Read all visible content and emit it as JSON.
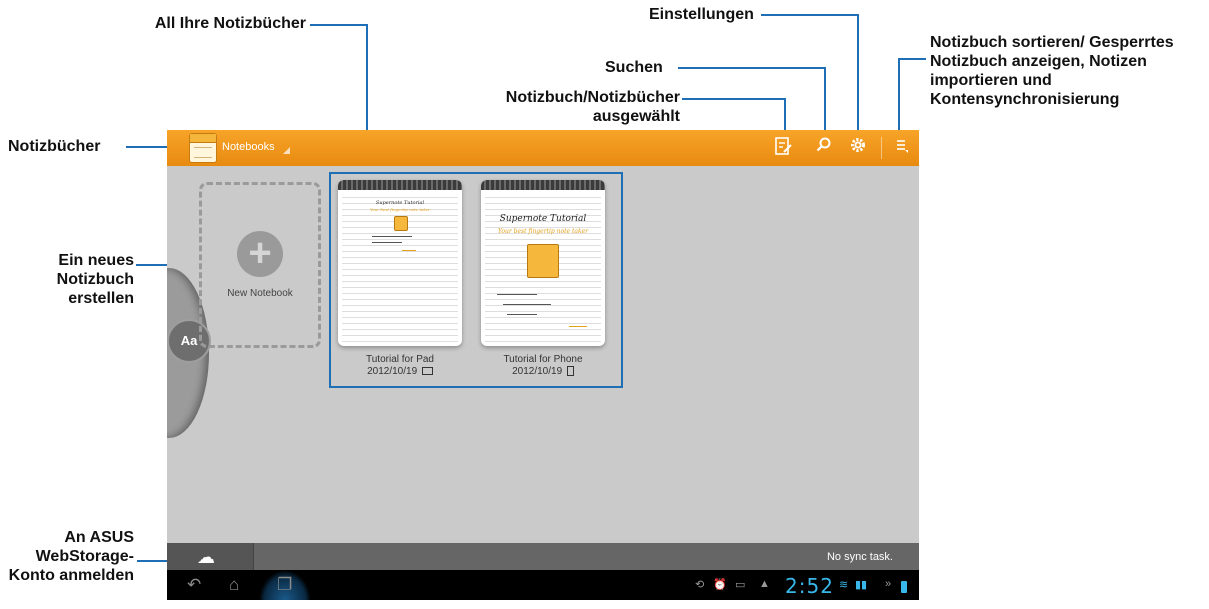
{
  "callouts": {
    "all_notebooks": "All Ihre Notizbücher",
    "settings": "Einstellungen",
    "sort_menu": "Notizbuch sortieren/ Gesperrtes Notizbuch anzeigen, Notizen importieren und Kontensynchronisierung",
    "search": "Suchen",
    "selected_notebooks": "Notizbuch/Notizbücher ausgewählt",
    "notebooks": "Notizbücher",
    "create_new": "Ein neues Notizbuch erstellen",
    "webstorage_login": "An ASUS WebStorage-Konto anmelden"
  },
  "app": {
    "title": "Notebooks",
    "toolbar_icons": [
      "select-notebooks-icon",
      "search-icon",
      "settings-gear-icon",
      "menu-icon"
    ],
    "accent_color": "#f29a1d"
  },
  "new_notebook": {
    "label": "New Notebook"
  },
  "notebooks": [
    {
      "preview_title": "Supernote Tutorial",
      "preview_subtitle": "Your best fingertip note taker",
      "name": "Tutorial for Pad",
      "date": "2012/10/19",
      "device_icon": "tablet-icon"
    },
    {
      "preview_title": "Supernote Tutorial",
      "preview_subtitle": "Your best fingertip note taker",
      "name": "Tutorial for Phone",
      "date": "2012/10/19",
      "device_icon": "phone-icon"
    }
  ],
  "sync": {
    "status": "No sync task."
  },
  "system": {
    "clock": "2:52",
    "clock_color": "#38b7e8"
  }
}
